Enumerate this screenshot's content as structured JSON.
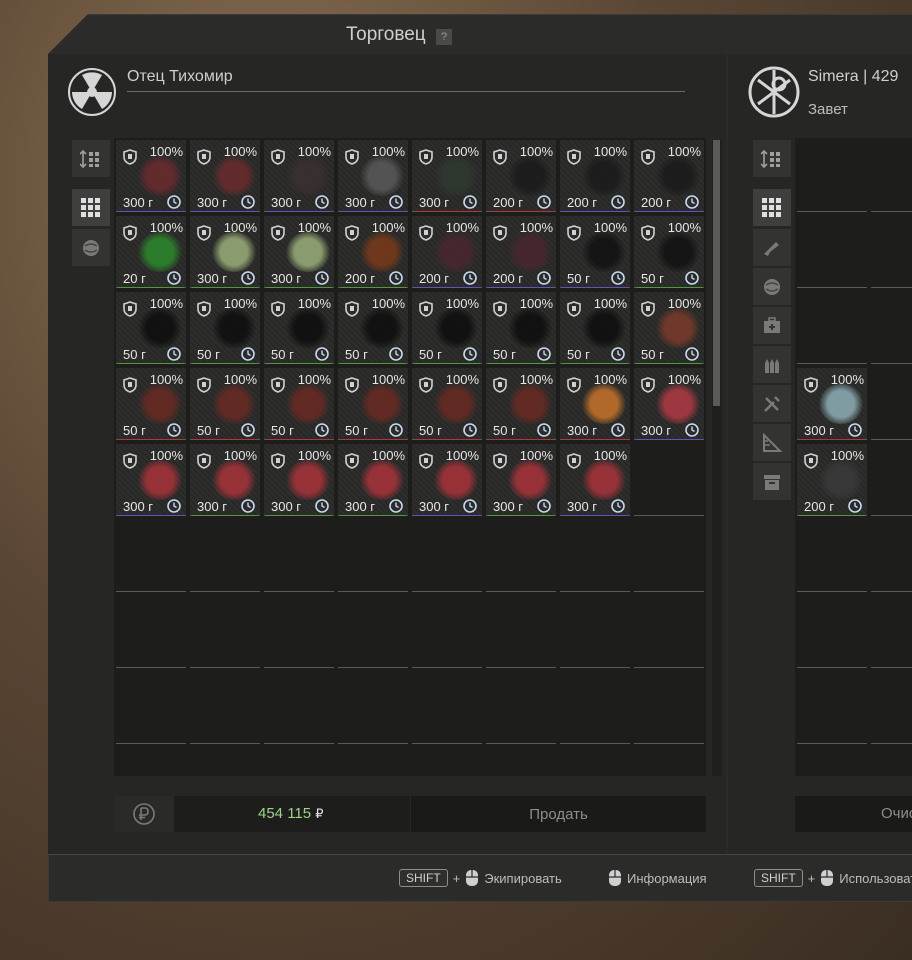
{
  "window": {
    "title": "Торговец",
    "help_label": "?"
  },
  "trader": {
    "name": "Отец Тихомир"
  },
  "player": {
    "name": "Simera | 429",
    "faction": "Завет"
  },
  "money": {
    "amount": "454 115",
    "currency": "₽"
  },
  "buttons": {
    "sell": "Продать",
    "clear": "Очис"
  },
  "hints": {
    "shift": "SHIFT",
    "plus": "+",
    "equip": "Экипировать",
    "info": "Информация",
    "use": "Использоват"
  },
  "colors": {
    "money": "#9fd28a",
    "rarity_green": "#4f9a3a",
    "rarity_purple": "#6a4fc2",
    "rarity_red": "#b03a3a"
  },
  "trader_items": [
    {
      "pct": "100%",
      "weight": "300 г",
      "art": "#6b2b2d",
      "rarity": "#6a4fc2"
    },
    {
      "pct": "100%",
      "weight": "300 г",
      "art": "#6b2b2d",
      "rarity": "#6a4fc2"
    },
    {
      "pct": "100%",
      "weight": "300 г",
      "art": "#3a3030",
      "rarity": "#6a4fc2"
    },
    {
      "pct": "100%",
      "weight": "300 г",
      "art": "#5a5a5a",
      "rarity": "#6a4fc2"
    },
    {
      "pct": "100%",
      "weight": "300 г",
      "art": "#2f3a2f",
      "rarity": "#b03a3a"
    },
    {
      "pct": "100%",
      "weight": "200 г",
      "art": "#1a1a1a",
      "rarity": "#b03a3a"
    },
    {
      "pct": "100%",
      "weight": "200 г",
      "art": "#1a1a1a",
      "rarity": "#6a4fc2"
    },
    {
      "pct": "100%",
      "weight": "200 г",
      "art": "#1a1a1a",
      "rarity": "#6a4fc2"
    },
    {
      "pct": "100%",
      "weight": "20 г",
      "art": "#2c8a2c",
      "rarity": "#4f9a3a"
    },
    {
      "pct": "100%",
      "weight": "300 г",
      "art": "#9bb07a",
      "rarity": "#4f9a3a"
    },
    {
      "pct": "100%",
      "weight": "300 г",
      "art": "#9bb07a",
      "rarity": "#4f9a3a"
    },
    {
      "pct": "100%",
      "weight": "200 г",
      "art": "#7a3a1a",
      "rarity": "#4f9a3a"
    },
    {
      "pct": "100%",
      "weight": "200 г",
      "art": "#4a2630",
      "rarity": "#6a4fc2"
    },
    {
      "pct": "100%",
      "weight": "200 г",
      "art": "#4a2630",
      "rarity": "#6a4fc2"
    },
    {
      "pct": "100%",
      "weight": "50 г",
      "art": "#111111",
      "rarity": "#6a4fc2"
    },
    {
      "pct": "100%",
      "weight": "50 г",
      "art": "#111111",
      "rarity": "#4f9a3a"
    },
    {
      "pct": "100%",
      "weight": "50 г",
      "art": "#0d0d0d",
      "rarity": "#4f9a3a"
    },
    {
      "pct": "100%",
      "weight": "50 г",
      "art": "#0d0d0d",
      "rarity": "#4f9a3a"
    },
    {
      "pct": "100%",
      "weight": "50 г",
      "art": "#0d0d0d",
      "rarity": "#4f9a3a"
    },
    {
      "pct": "100%",
      "weight": "50 г",
      "art": "#0d0d0d",
      "rarity": "#4f9a3a"
    },
    {
      "pct": "100%",
      "weight": "50 г",
      "art": "#0d0d0d",
      "rarity": "#4f9a3a"
    },
    {
      "pct": "100%",
      "weight": "50 г",
      "art": "#0d0d0d",
      "rarity": "#4f9a3a"
    },
    {
      "pct": "100%",
      "weight": "50 г",
      "art": "#0d0d0d",
      "rarity": "#4f9a3a"
    },
    {
      "pct": "100%",
      "weight": "50 г",
      "art": "#7a3a2a",
      "rarity": "#4f9a3a"
    },
    {
      "pct": "100%",
      "weight": "50 г",
      "art": "#6a2a22",
      "rarity": "#b03a3a"
    },
    {
      "pct": "100%",
      "weight": "50 г",
      "art": "#6a2a22",
      "rarity": "#b03a3a"
    },
    {
      "pct": "100%",
      "weight": "50 г",
      "art": "#6a2a22",
      "rarity": "#b03a3a"
    },
    {
      "pct": "100%",
      "weight": "50 г",
      "art": "#6a2a22",
      "rarity": "#b03a3a"
    },
    {
      "pct": "100%",
      "weight": "50 г",
      "art": "#6a2a22",
      "rarity": "#b03a3a"
    },
    {
      "pct": "100%",
      "weight": "50 г",
      "art": "#6a2a22",
      "rarity": "#b03a3a"
    },
    {
      "pct": "100%",
      "weight": "300 г",
      "art": "#c8742a",
      "rarity": "#b03a3a"
    },
    {
      "pct": "100%",
      "weight": "300 г",
      "art": "#b03a44",
      "rarity": "#6a4fc2"
    },
    {
      "pct": "100%",
      "weight": "300 г",
      "art": "#a8333a",
      "rarity": "#6a4fc2"
    },
    {
      "pct": "100%",
      "weight": "300 г",
      "art": "#a8333a",
      "rarity": "#4f9a3a"
    },
    {
      "pct": "100%",
      "weight": "300 г",
      "art": "#a8333a",
      "rarity": "#4f9a3a"
    },
    {
      "pct": "100%",
      "weight": "300 г",
      "art": "#a8333a",
      "rarity": "#4f9a3a"
    },
    {
      "pct": "100%",
      "weight": "300 г",
      "art": "#a8333a",
      "rarity": "#6a4fc2"
    },
    {
      "pct": "100%",
      "weight": "300 г",
      "art": "#a8333a",
      "rarity": "#4f9a3a"
    },
    {
      "pct": "100%",
      "weight": "300 г",
      "art": "#a8333a",
      "rarity": "#6a4fc2"
    }
  ],
  "player_items": [
    {
      "pct": "100%",
      "weight": "300 г",
      "art": "#8fb0b8",
      "rarity": "#b03a3a"
    },
    {
      "pct": "100%",
      "weight": "200 г",
      "art": "#3a3a3a",
      "rarity": "#4f9a3a"
    }
  ],
  "left_tabs": [
    "sort-icon",
    "grid-icon",
    "artifact-icon"
  ],
  "right_tabs": [
    "sort-icon",
    "grid-icon",
    "weapon-icon",
    "artifact-icon",
    "medkit-icon",
    "ammo-icon",
    "tools-icon",
    "ruler-icon",
    "box-icon"
  ]
}
